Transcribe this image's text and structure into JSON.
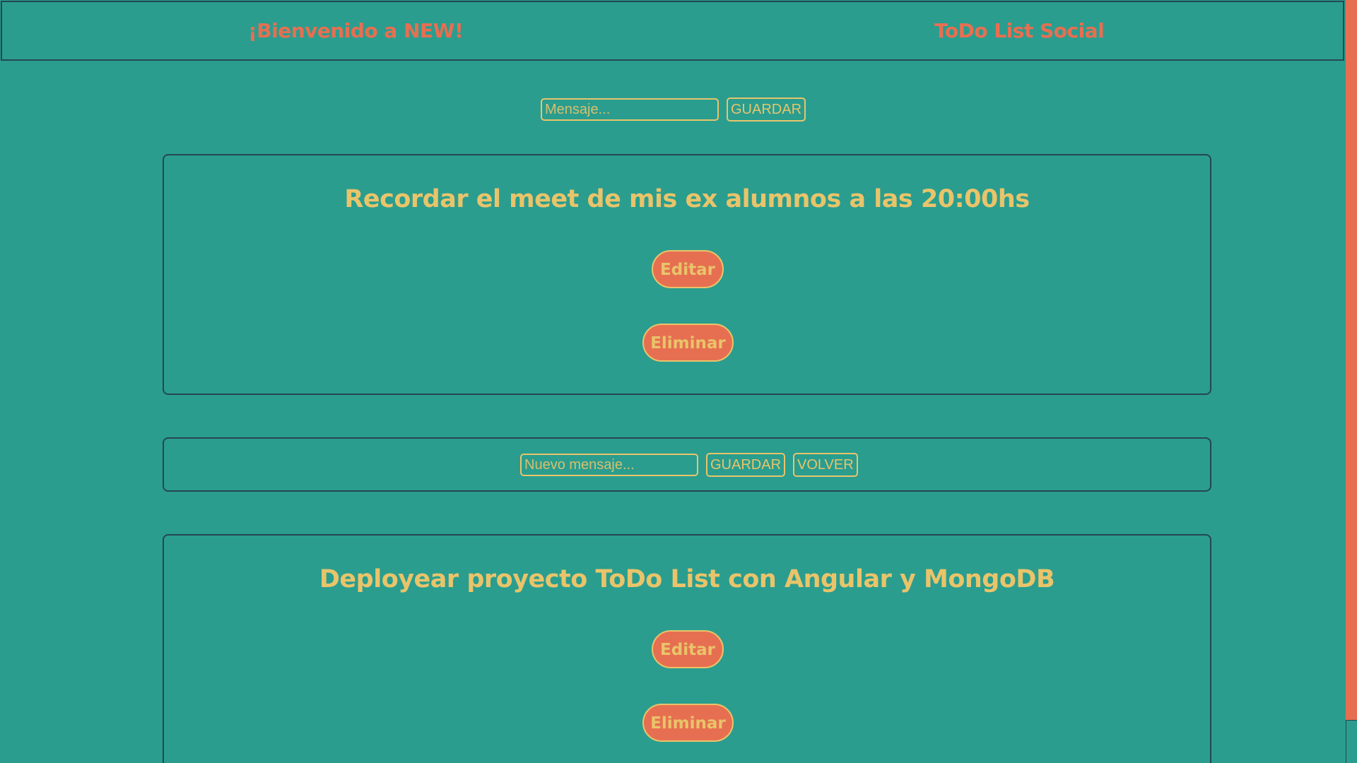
{
  "header": {
    "welcome": "¡Bienvenido a NEW!",
    "app_title": "ToDo List Social"
  },
  "new_message_form": {
    "placeholder": "Mensaje...",
    "value": "",
    "save_label": "GUARDAR"
  },
  "todos": [
    {
      "text": "Recordar el meet de mis ex alumnos a las 20:00hs",
      "edit_label": "Editar",
      "delete_label": "Eliminar"
    },
    {
      "text": "Deployear proyecto ToDo List con Angular y MongoDB",
      "edit_label": "Editar",
      "delete_label": "Eliminar"
    }
  ],
  "edit_form": {
    "placeholder": "Nuevo mensaje...",
    "value": "",
    "save_label": "GUARDAR",
    "back_label": "VOLVER"
  },
  "colors": {
    "background": "#2a9d8f",
    "accent": "#e76f51",
    "text": "#e9c46a",
    "border": "#264653"
  }
}
